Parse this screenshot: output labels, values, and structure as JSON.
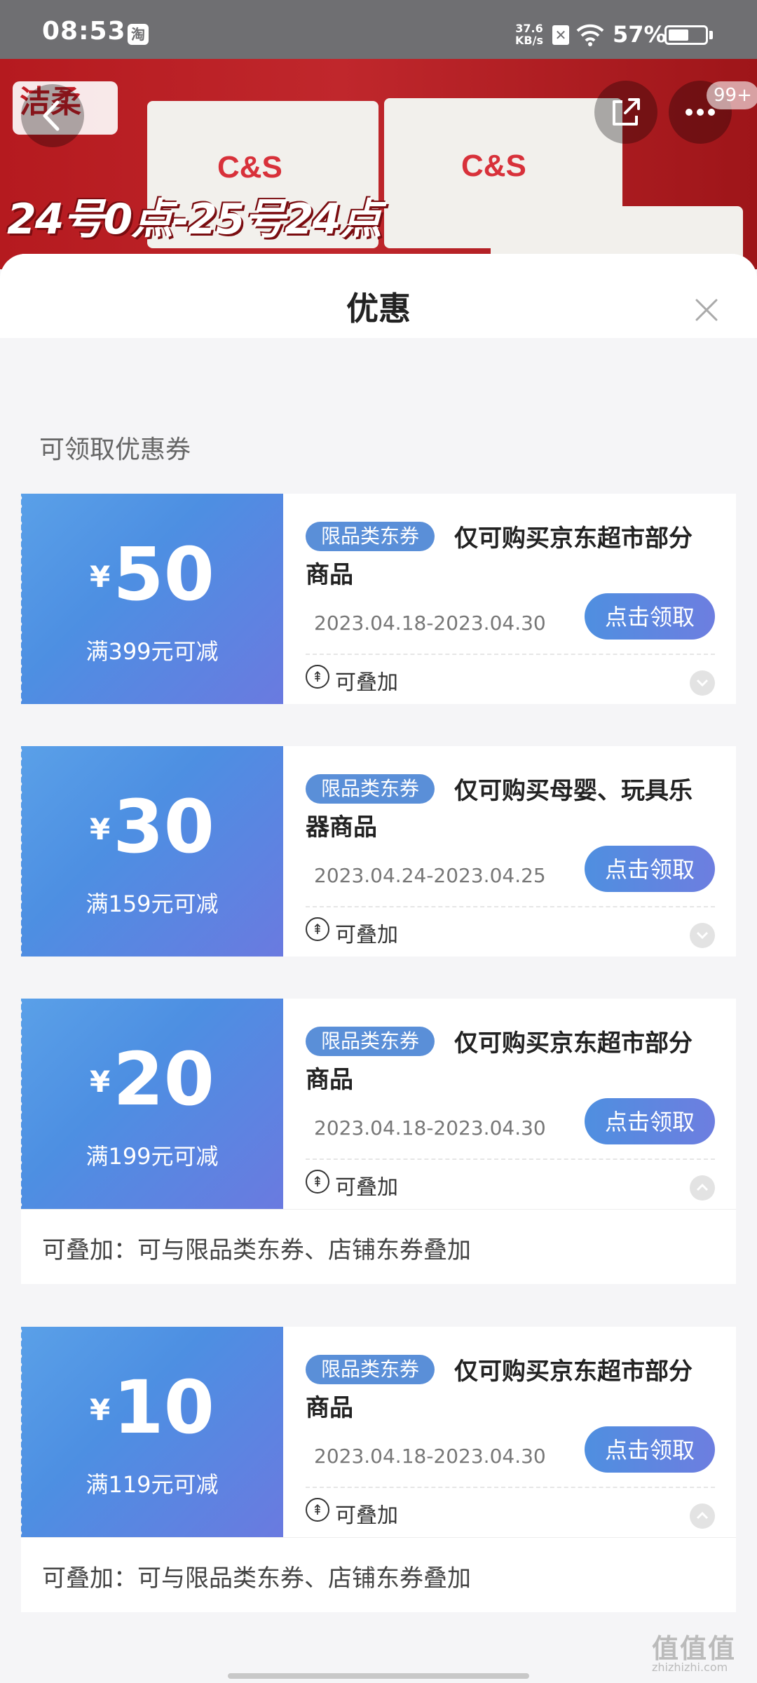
{
  "status_bar": {
    "time": "08:53",
    "app_icon_text": "淘",
    "net_speed_value": "37.6",
    "net_speed_unit": "KB/s",
    "battery_text": "57%",
    "battery_level": 0.57
  },
  "banner": {
    "brand_logo": "洁柔",
    "product_logo": "C&S",
    "promo_text": "24号0点-25号24点",
    "more_badge": "99+"
  },
  "sheet": {
    "title": "优惠",
    "section_title": "可领取优惠券"
  },
  "coupons": [
    {
      "currency": "¥",
      "amount": "50",
      "condition": "满399元可减",
      "tag": "限品类东券",
      "title": "仅可购买京东超市部分商品",
      "date": "2023.04.18-2023.04.30",
      "claim_label": "点击领取",
      "stack_label": "可叠加"
    },
    {
      "currency": "¥",
      "amount": "30",
      "condition": "满159元可减",
      "tag": "限品类东券",
      "title": "仅可购买母婴、玩具乐器商品",
      "date": "2023.04.24-2023.04.25",
      "claim_label": "点击领取",
      "stack_label": "可叠加"
    },
    {
      "currency": "¥",
      "amount": "20",
      "condition": "满199元可减",
      "tag": "限品类东券",
      "title": "仅可购买京东超市部分商品",
      "date": "2023.04.18-2023.04.30",
      "claim_label": "点击领取",
      "stack_label": "可叠加",
      "detail": "可叠加：可与限品类东券、店铺东券叠加"
    },
    {
      "currency": "¥",
      "amount": "10",
      "condition": "满119元可减",
      "tag": "限品类东券",
      "title": "仅可购买京东超市部分商品",
      "date": "2023.04.18-2023.04.30",
      "claim_label": "点击领取",
      "stack_label": "可叠加",
      "detail": "可叠加：可与限品类东券、店铺东券叠加"
    }
  ],
  "watermark": {
    "text": "值值值",
    "sub": "zhizhizhi.com"
  },
  "icons": {
    "back": "back-icon",
    "share": "share-icon",
    "more": "more-icon",
    "close": "close-icon",
    "stack": "stack-icon",
    "expand": "chevron-icon"
  },
  "colors": {
    "coupon_gradient_start": "#5aa0e8",
    "coupon_gradient_end": "#6a7ae0",
    "tag_bg": "#5a8fd8",
    "banner_red": "#c0272c"
  }
}
